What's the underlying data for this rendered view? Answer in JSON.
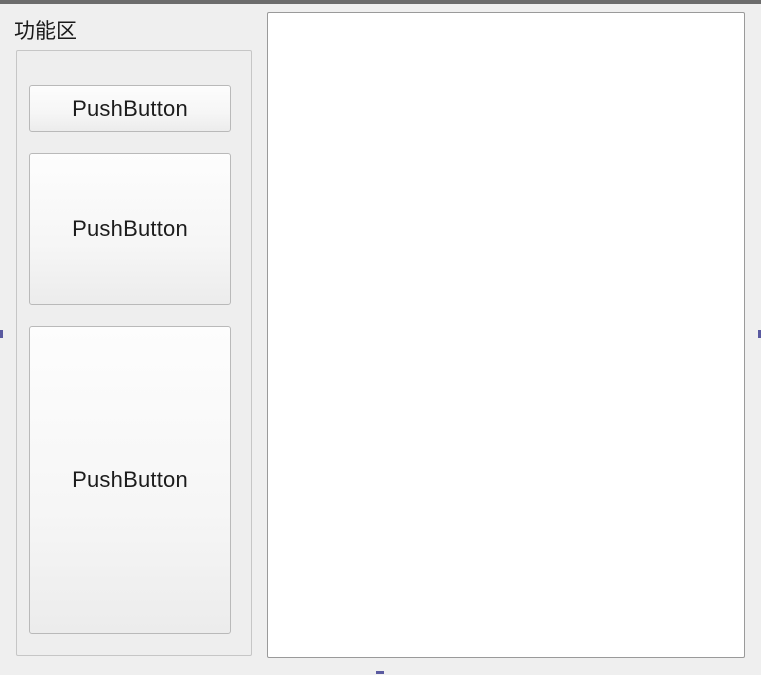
{
  "group": {
    "title": "功能区"
  },
  "buttons": [
    {
      "label": "PushButton"
    },
    {
      "label": "PushButton"
    },
    {
      "label": "PushButton"
    }
  ],
  "editor": {
    "value": ""
  }
}
